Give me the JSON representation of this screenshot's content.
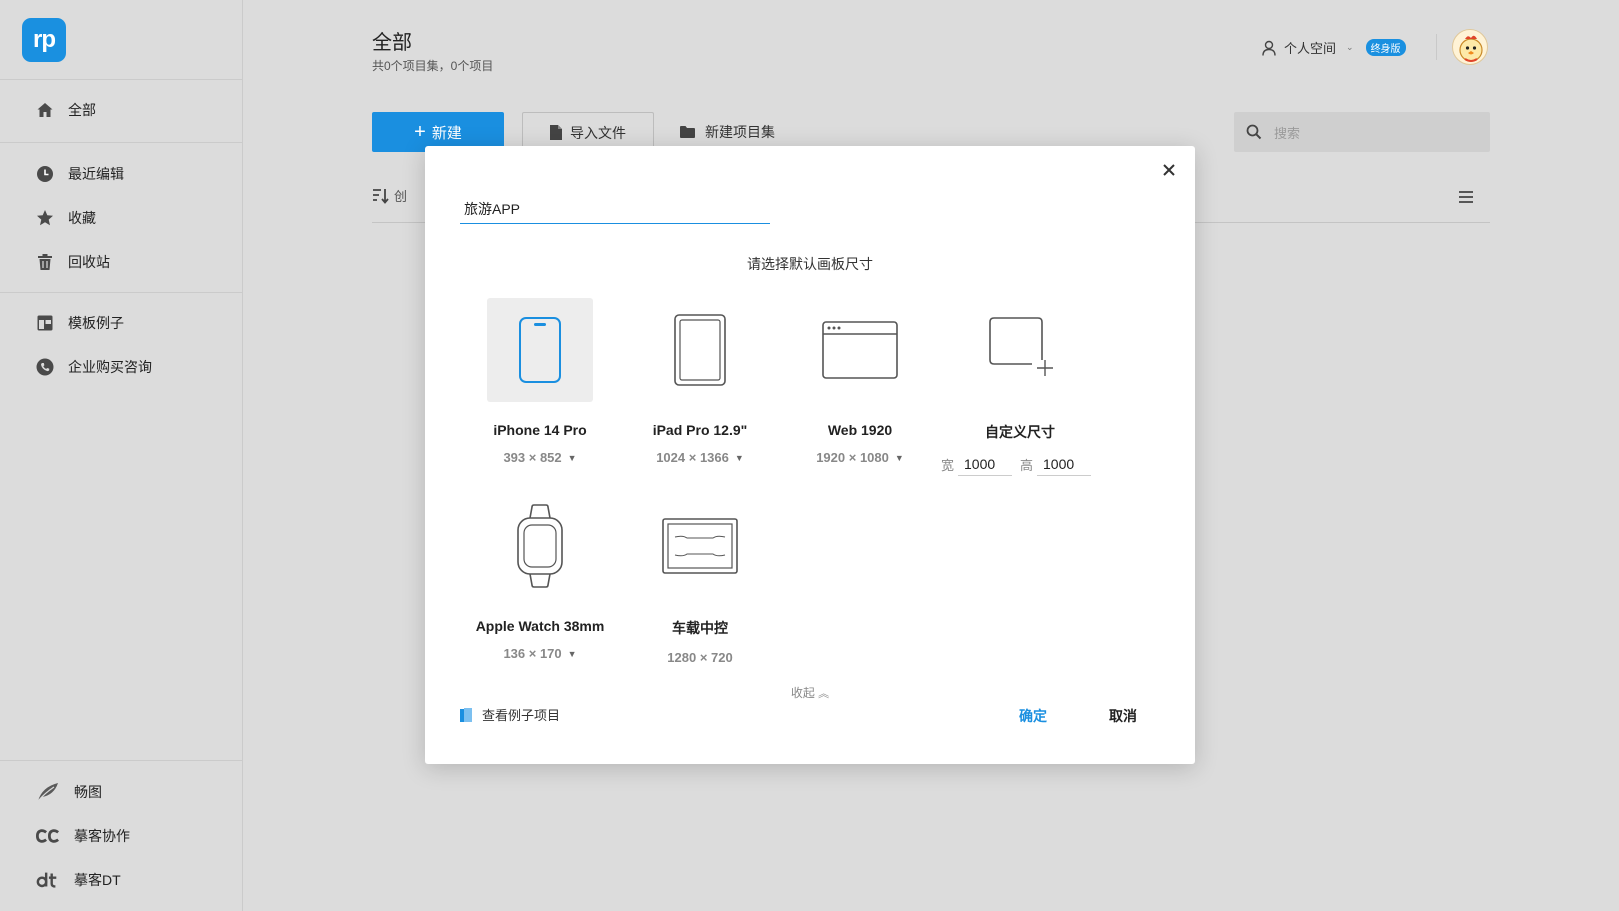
{
  "sidebar": {
    "logo_text": "rp",
    "items": [
      {
        "label": "全部",
        "icon": "home-icon"
      },
      {
        "label": "最近编辑",
        "icon": "clock-icon"
      },
      {
        "label": "收藏",
        "icon": "star-icon"
      },
      {
        "label": "回收站",
        "icon": "trash-icon"
      },
      {
        "label": "模板例子",
        "icon": "template-icon"
      },
      {
        "label": "企业购买咨询",
        "icon": "phone-icon"
      }
    ],
    "bottom_items": [
      {
        "label": "畅图",
        "icon": "leaf-icon"
      },
      {
        "label": "摹客协作",
        "icon": "cc-icon"
      },
      {
        "label": "摹客DT",
        "icon": "dt-icon"
      }
    ]
  },
  "header": {
    "title": "全部",
    "subtitle": "共0个项目集，0个项目",
    "workspace": "个人空间",
    "plan_badge": "终身版"
  },
  "toolbar": {
    "new_label": "新建",
    "import_label": "导入文件",
    "new_folder_label": "新建项目集",
    "search_placeholder": "搜索",
    "sort_label": "创"
  },
  "modal": {
    "name_value": "旅游APP",
    "heading": "请选择默认画板尺寸",
    "devices": [
      {
        "name": "iPhone 14 Pro",
        "size": "393 × 852",
        "icon": "phone-device-icon",
        "selected": true
      },
      {
        "name": "iPad Pro 12.9\"",
        "size": "1024 × 1366",
        "icon": "tablet-device-icon"
      },
      {
        "name": "Web 1920",
        "size": "1920 × 1080",
        "icon": "browser-device-icon"
      },
      {
        "name": "自定义尺寸",
        "icon": "custom-size-icon"
      },
      {
        "name": "Apple Watch 38mm",
        "size": "136 × 170",
        "icon": "watch-device-icon"
      },
      {
        "name": "车载中控",
        "size": "1280 × 720",
        "icon": "car-display-icon"
      }
    ],
    "custom": {
      "width_label": "宽",
      "width_value": "1000",
      "height_label": "高",
      "height_value": "1000"
    },
    "collapse_label": "收起",
    "example_link": "查看例子项目",
    "ok_label": "确定",
    "cancel_label": "取消"
  },
  "colors": {
    "accent": "#1a8fe0",
    "background": "#dcdcdc",
    "modal_bg": "#ffffff",
    "selected_thumb": "#ededed"
  }
}
